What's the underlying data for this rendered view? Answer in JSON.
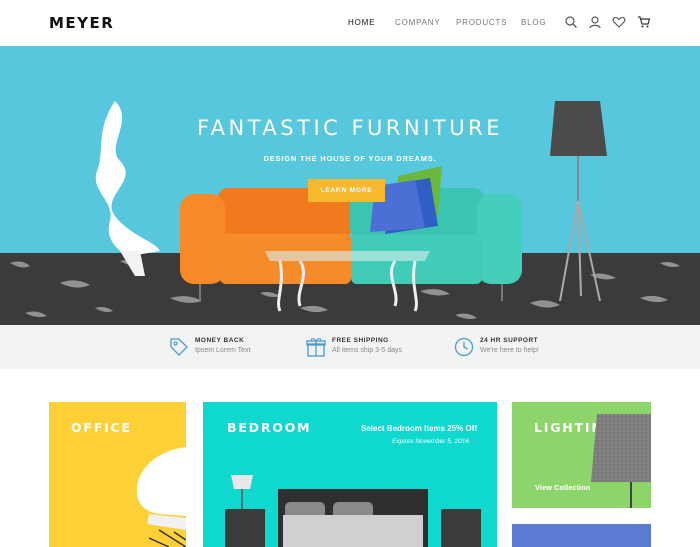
{
  "header": {
    "logo": "MEYER",
    "nav": [
      {
        "label": "HOME"
      },
      {
        "label": "COMPANY"
      },
      {
        "label": "PRODUCTS"
      },
      {
        "label": "BLOG"
      }
    ],
    "icons": [
      "search-icon",
      "user-icon",
      "heart-icon",
      "cart-icon"
    ]
  },
  "hero": {
    "title": "FANTASTIC FURNITURE",
    "subtitle": "DESIGN THE HOUSE OF YOUR DREAMS.",
    "button": "LEARN MORE",
    "colors": {
      "background": "#56c7dc",
      "button": "#f6b92e",
      "sofa_left": "#f57f1e",
      "sofa_right": "#3cc9b4"
    }
  },
  "features": [
    {
      "icon": "tag-icon",
      "title": "MONEY BACK",
      "text": "Ipsem Lorem Text"
    },
    {
      "icon": "gift-icon",
      "title": "FREE SHIPPING",
      "text": "All items ship 3-5 days"
    },
    {
      "icon": "clock-icon",
      "title": "24 HR SUPPORT",
      "text": "We're here to help!"
    }
  ],
  "categories": {
    "office": {
      "label": "OFFICE",
      "color": "#fdd036"
    },
    "bedroom": {
      "label": "BEDROOM",
      "promo": "Select Bedroom Items 25% Off",
      "expires": "Expires November 5, 2016",
      "color": "#0fd8cf"
    },
    "lighting": {
      "label": "LIGHTING",
      "link": "View Collection",
      "color": "#8dd56a"
    },
    "living": {
      "color": "#5b7ad1"
    }
  }
}
